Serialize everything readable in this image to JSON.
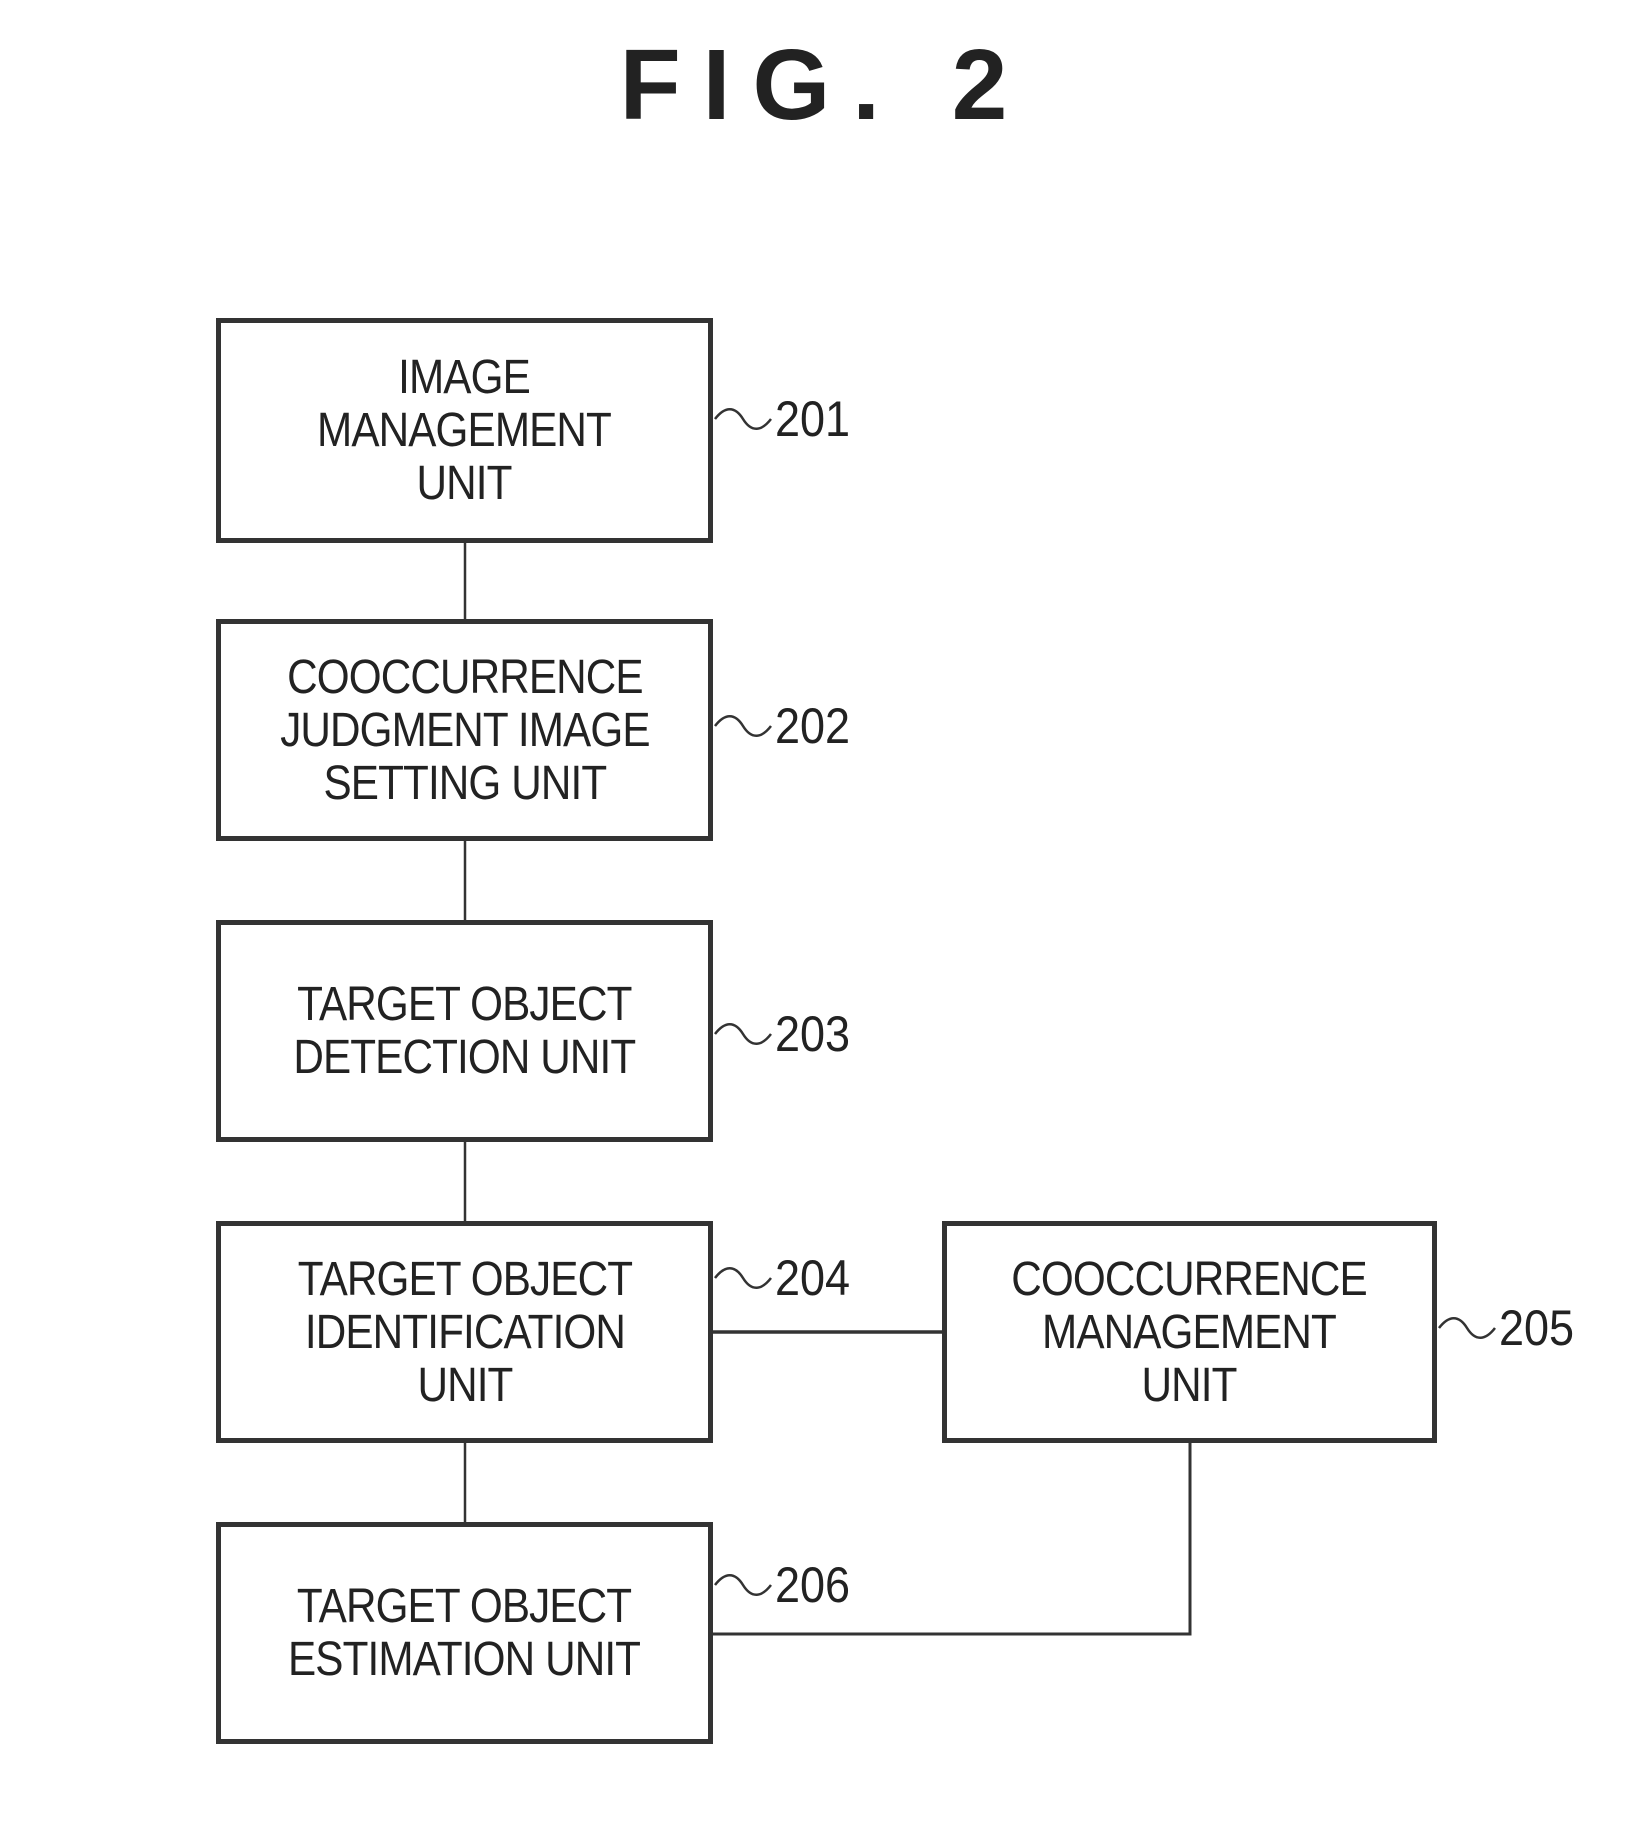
{
  "figure": {
    "title": "FIG. 2"
  },
  "blocks": [
    {
      "id": "201",
      "label": "IMAGE\nMANAGEMENT\nUNIT",
      "ref": "201"
    },
    {
      "id": "202",
      "label": "COOCCURRENCE\nJUDGMENT IMAGE\nSETTING UNIT",
      "ref": "202"
    },
    {
      "id": "203",
      "label": "TARGET OBJECT\nDETECTION UNIT",
      "ref": "203"
    },
    {
      "id": "204",
      "label": "TARGET OBJECT\nIDENTIFICATION\nUNIT",
      "ref": "204"
    },
    {
      "id": "205",
      "label": "COOCCURRENCE\nMANAGEMENT\nUNIT",
      "ref": "205"
    },
    {
      "id": "206",
      "label": "TARGET OBJECT\nESTIMATION UNIT",
      "ref": "206"
    }
  ],
  "connections": [
    {
      "from": "201",
      "to": "202"
    },
    {
      "from": "202",
      "to": "203"
    },
    {
      "from": "203",
      "to": "204"
    },
    {
      "from": "204",
      "to": "205"
    },
    {
      "from": "204",
      "to": "206"
    },
    {
      "from": "205",
      "to": "206"
    }
  ],
  "colors": {
    "line": "#333333",
    "text": "#222222",
    "background": "#ffffff"
  }
}
